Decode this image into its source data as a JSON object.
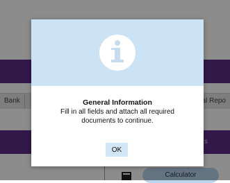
{
  "background": {
    "tabs": [
      "Bank",
      "gal Repo"
    ],
    "purple_text": "s",
    "calculator_label": "Calculator"
  },
  "dialog": {
    "title": "General Information",
    "message": "Fill in all fields and attach all required documents to continue.",
    "ok_label": "OK",
    "icon": "info-icon",
    "colors": {
      "header_bg": "#cbe3f5",
      "ok_bg": "#d3e6f6",
      "accent_purple": "#5b2d86"
    }
  }
}
